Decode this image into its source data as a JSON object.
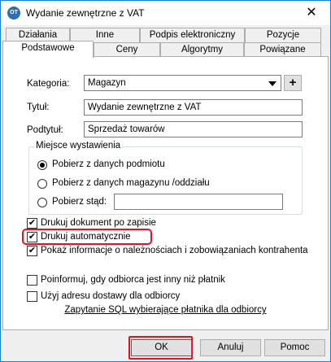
{
  "window": {
    "title": "Wydanie zewnętrzne z VAT",
    "app_icon_text": "OT",
    "close_glyph": "✕"
  },
  "tabs": {
    "row1": [
      "Działania",
      "Inne",
      "Podpis elektroniczny",
      "Pozycje"
    ],
    "row2": [
      "Podstawowe",
      "Ceny",
      "Algorytmy",
      "Powiązane"
    ],
    "active": "Podstawowe"
  },
  "form": {
    "kategoria": {
      "label": "Kategoria:",
      "value": "Magazyn",
      "add_label": "+"
    },
    "tytul": {
      "label": "Tytuł:",
      "value": "Wydanie zewnętrzne z VAT"
    },
    "podtytul": {
      "label": "Podtytuł:",
      "value": "Sprzedaż towarów"
    }
  },
  "miejsce": {
    "title": "Miejsce wystawienia",
    "options": [
      {
        "label": "Pobierz z danych podmiotu",
        "selected": true
      },
      {
        "label": "Pobierz z danych magazynu /oddziału",
        "selected": false
      },
      {
        "label": "Pobierz stąd:",
        "selected": false
      }
    ],
    "stad_value": ""
  },
  "checkboxes": [
    {
      "label": "Drukuj dokument po zapisie",
      "checked": true
    },
    {
      "label": "Drukuj automatycznie",
      "checked": true
    },
    {
      "label": "Pokaż informacje o należnościach i zobowiązaniach kontrahenta",
      "checked": true
    },
    {
      "label": "Poinformuj, gdy odbiorca jest inny niż płatnik",
      "checked": false
    },
    {
      "label": "Użyj adresu dostawy dla odbiorcy",
      "checked": false
    }
  ],
  "sql_link": "Zapytanie SQL wybierające płatnika dla odbiorcy",
  "buttons": {
    "ok": "OK",
    "cancel": "Anuluj",
    "help": "Pomoc"
  },
  "colors": {
    "highlight": "#e81123",
    "accent": "#0078d7"
  },
  "icons": {
    "check": "✔"
  }
}
